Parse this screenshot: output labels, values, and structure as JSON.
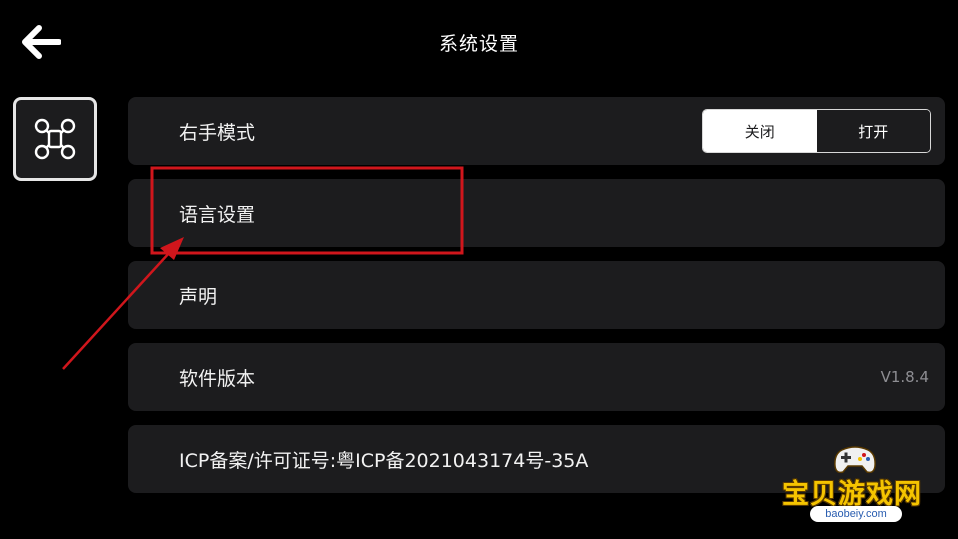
{
  "header": {
    "title": "系统设置",
    "back_icon": "arrow-left-icon"
  },
  "sidebar": {
    "tab_icon": "drone-icon"
  },
  "settings": {
    "right_hand_mode": {
      "label": "右手模式",
      "options": [
        "关闭",
        "打开"
      ],
      "selected": "关闭"
    },
    "language": {
      "label": "语言设置"
    },
    "statement": {
      "label": "声明"
    },
    "software_version": {
      "label": "软件版本",
      "value": "V1.8.4"
    },
    "icp": {
      "label": "ICP备案/许可证号:粤ICP备2021043174号-35A"
    }
  },
  "watermark": {
    "name": "宝贝游戏网",
    "url": "baobeiy.com"
  },
  "colors": {
    "background": "#000000",
    "row": "#1c1c1e",
    "annotation": "#d0161c",
    "version_text": "#8e8e93"
  }
}
